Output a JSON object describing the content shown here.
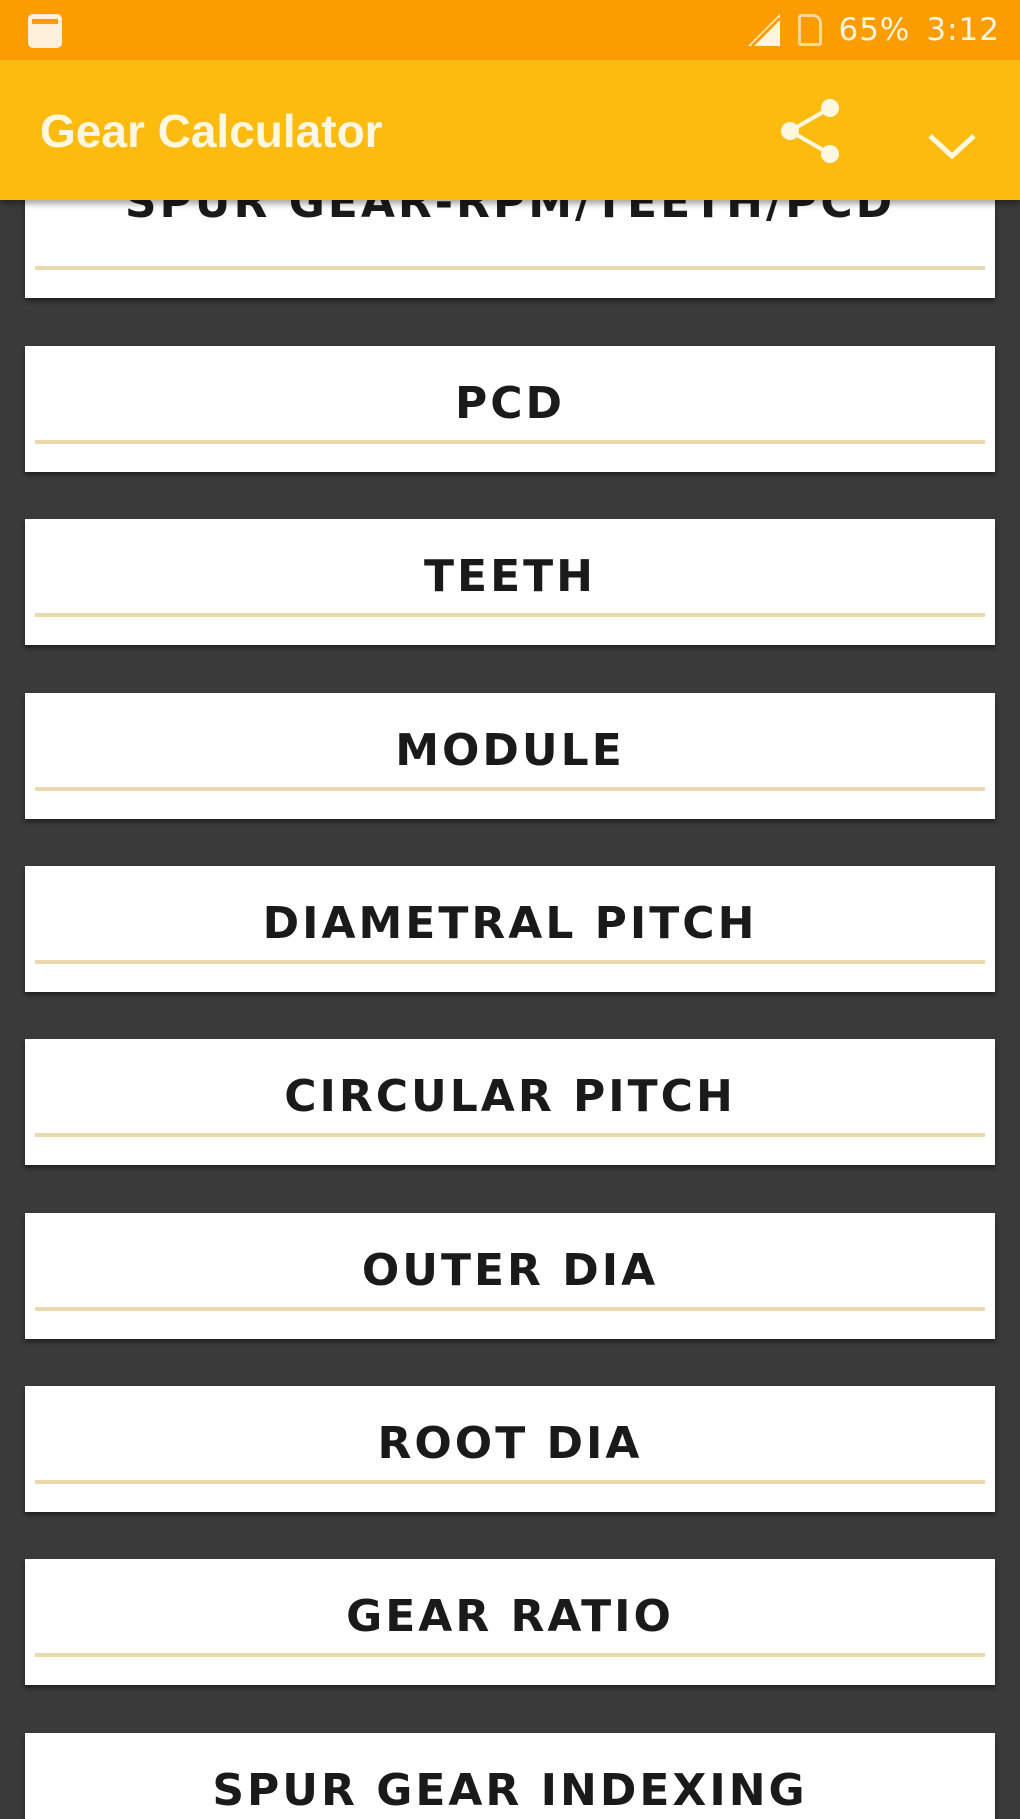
{
  "status_bar": {
    "battery": "65%",
    "time": "3:12"
  },
  "app_bar": {
    "title": "Gear Calculator",
    "icons": [
      "share-icon",
      "chevron-down-icon"
    ]
  },
  "menu": {
    "items": [
      {
        "label": "SPUR GEAR-RPM/TEETH/PCD"
      },
      {
        "label": "PCD"
      },
      {
        "label": "TEETH"
      },
      {
        "label": "MODULE"
      },
      {
        "label": "DIAMETRAL PITCH"
      },
      {
        "label": "CIRCULAR PITCH"
      },
      {
        "label": "OUTER DIA"
      },
      {
        "label": "ROOT DIA"
      },
      {
        "label": "GEAR RATIO"
      },
      {
        "label": "SPUR GEAR INDEXING"
      }
    ]
  },
  "colors": {
    "status_bar": "#fb9d00",
    "app_bar": "#fdbb10",
    "background": "#3a3a3a",
    "underline": "#ead9ad"
  }
}
